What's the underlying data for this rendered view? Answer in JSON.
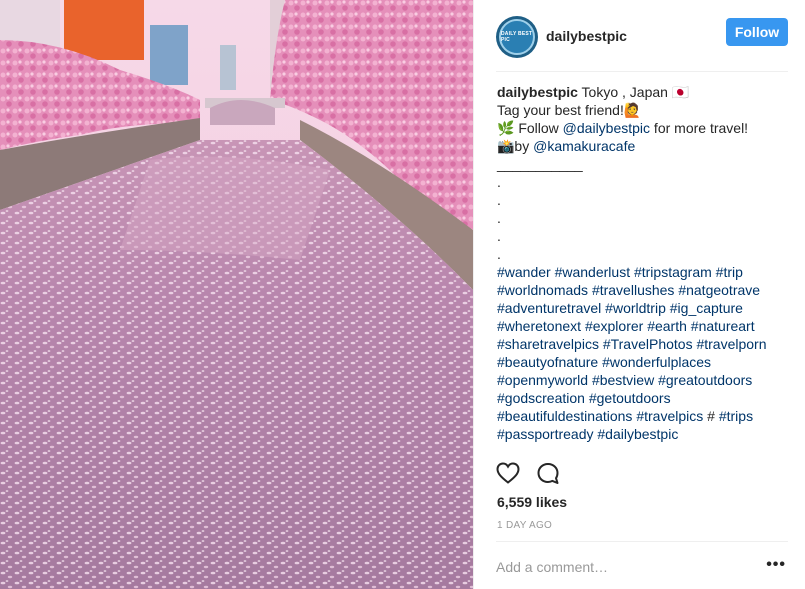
{
  "header": {
    "avatar_text": "DAILY BEST PIC",
    "username": "dailybestpic",
    "follow_label": "Follow"
  },
  "caption": {
    "username": "dailybestpic",
    "location_text": " Tokyo , Japan 🇯🇵",
    "line2": "Tag your best friend!🙋",
    "line3_prefix": "🌿 Follow ",
    "line3_mention": "@dailybestpic",
    "line3_suffix": " for more travel!",
    "line4_prefix": "📸by ",
    "line4_mention": "@kamakuracafe",
    "divider": "___________",
    "dots": [
      ".",
      ".",
      ".",
      ".",
      "."
    ],
    "hashtag_lines": [
      "#wander #wanderlust #tripstagram #trip",
      "#worldnomads #travellushes #natgeotrave",
      "#adventuretravel #worldtrip #ig_capture",
      "#wheretonext #explorer #earth #natureart",
      "#sharetravelpics #TravelPhotos #travelporn",
      "#beautyofnature #wonderfulplaces",
      "#openmyworld #bestview #greatoutdoors",
      "#godscreation #getoutdoors",
      "#beautifuldestinations #travelpics",
      "#passportready #dailybestpic"
    ],
    "line9_suffix_hash": " # ",
    "line9_suffix_tag": "#trips"
  },
  "actions": {
    "like_icon": "heart-icon",
    "comment_icon": "comment-bubble-icon"
  },
  "likes": "6,559 likes",
  "time_ago": "1 DAY AGO",
  "comment": {
    "placeholder": "Add a comment…",
    "more_label": "•••"
  },
  "colors": {
    "follow_bg": "#3897f0",
    "link": "#003569",
    "muted": "#999999"
  }
}
